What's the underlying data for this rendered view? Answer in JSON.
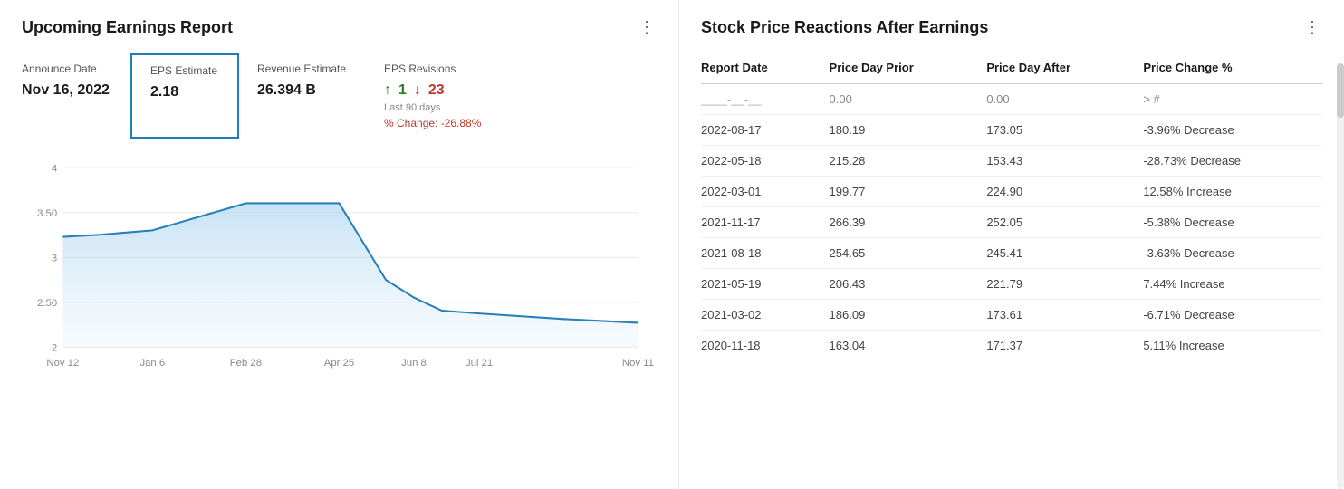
{
  "left": {
    "title": "Upcoming Earnings Report",
    "more_icon": "⋮",
    "announce_date_label": "Announce Date",
    "announce_date_value": "Nov 16, 2022",
    "eps_estimate_label": "EPS Estimate",
    "eps_estimate_value": "2.18",
    "revenue_estimate_label": "Revenue Estimate",
    "revenue_estimate_value": "26.394 B",
    "eps_revisions_label": "EPS Revisions",
    "eps_rev_up": "1",
    "eps_rev_down": "23",
    "eps_rev_sub": "Last 90 days",
    "pct_change": "% Change: -26.88%",
    "chart": {
      "x_labels": [
        "Nov 12",
        "Jan 6",
        "Feb 28",
        "Apr 25",
        "Jun 8",
        "Jul 21",
        "Nov 11"
      ],
      "y_labels": [
        "4",
        "3.50",
        "3",
        "2.50",
        "2"
      ],
      "y_min": 1.9,
      "y_max": 4.1
    }
  },
  "right": {
    "title": "Stock Price Reactions After Earnings",
    "more_icon": "⋮",
    "columns": [
      "Report Date",
      "Price Day Prior",
      "Price Day After",
      "Price Change %"
    ],
    "rows": [
      {
        "date": "____-__-__",
        "prior": "0.00",
        "after": "0.00",
        "change": "> #",
        "type": "placeholder"
      },
      {
        "date": "2022-08-17",
        "prior": "180.19",
        "after": "173.05",
        "change": "-3.96% Decrease",
        "type": "decrease"
      },
      {
        "date": "2022-05-18",
        "prior": "215.28",
        "after": "153.43",
        "change": "-28.73% Decrease",
        "type": "decrease"
      },
      {
        "date": "2022-03-01",
        "prior": "199.77",
        "after": "224.90",
        "change": "12.58% Increase",
        "type": "increase"
      },
      {
        "date": "2021-11-17",
        "prior": "266.39",
        "after": "252.05",
        "change": "-5.38% Decrease",
        "type": "decrease"
      },
      {
        "date": "2021-08-18",
        "prior": "254.65",
        "after": "245.41",
        "change": "-3.63% Decrease",
        "type": "decrease"
      },
      {
        "date": "2021-05-19",
        "prior": "206.43",
        "after": "221.79",
        "change": "7.44% Increase",
        "type": "increase"
      },
      {
        "date": "2021-03-02",
        "prior": "186.09",
        "after": "173.61",
        "change": "-6.71% Decrease",
        "type": "decrease"
      },
      {
        "date": "2020-11-18",
        "prior": "163.04",
        "after": "171.37",
        "change": "5.11% Increase",
        "type": "increase"
      }
    ]
  }
}
